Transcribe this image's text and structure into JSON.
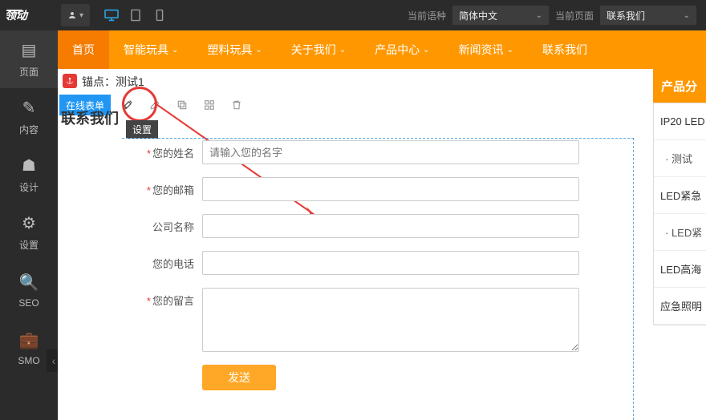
{
  "topbar": {
    "lang_label": "当前语种",
    "lang_value": "简体中文",
    "page_label": "当前页面",
    "page_value": "联系我们"
  },
  "sidebar": {
    "items": [
      {
        "label": "页面"
      },
      {
        "label": "内容"
      },
      {
        "label": "设计"
      },
      {
        "label": "设置"
      },
      {
        "label": "SEO"
      },
      {
        "label": "SMO"
      }
    ]
  },
  "nav": {
    "items": [
      {
        "label": "首页",
        "has_sub": false
      },
      {
        "label": "智能玩具",
        "has_sub": true
      },
      {
        "label": "塑料玩具",
        "has_sub": true
      },
      {
        "label": "关于我们",
        "has_sub": true
      },
      {
        "label": "产品中心",
        "has_sub": true
      },
      {
        "label": "新闻资讯",
        "has_sub": true
      },
      {
        "label": "联系我们",
        "has_sub": false
      }
    ]
  },
  "editor": {
    "anchor_label": "锚点：测试1",
    "chip_label": "在线表单",
    "tooltip": "设置",
    "heading": "联系我们"
  },
  "form": {
    "name_label": "您的姓名",
    "name_placeholder": "请输入您的名字",
    "email_label": "您的邮箱",
    "company_label": "公司名称",
    "phone_label": "您的电话",
    "message_label": "您的留言",
    "submit": "发送"
  },
  "right": {
    "header": "产品分",
    "items": [
      {
        "label": "IP20 LED",
        "sub": false
      },
      {
        "label": "· 测试",
        "sub": true
      },
      {
        "label": "LED紧急",
        "sub": false
      },
      {
        "label": "· LED紧",
        "sub": true
      },
      {
        "label": "LED高海",
        "sub": false
      },
      {
        "label": "应急照明",
        "sub": false
      }
    ]
  }
}
